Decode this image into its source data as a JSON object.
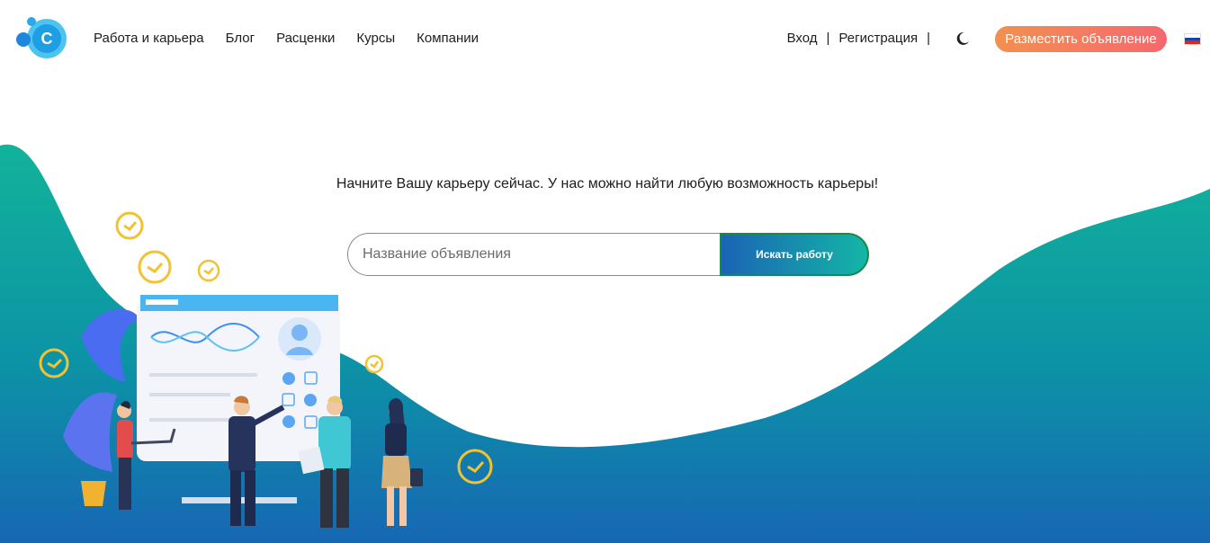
{
  "header": {
    "nav": [
      "Работа и карьера",
      "Блог",
      "Расценки",
      "Курсы",
      "Компании"
    ],
    "login": "Вход",
    "register": "Регистрация",
    "post_button": "Разместить объявление"
  },
  "hero": {
    "tagline": "Начните Вашу карьеру сейчас. У нас можно найти любую возможность карьеры!",
    "search_placeholder": "Название объявления",
    "search_button": "Искать работу"
  },
  "colors": {
    "accent_orange": "#f39050",
    "accent_pink": "#f4686f",
    "wave_teal": "#13a898",
    "wave_blue": "#1464b0"
  }
}
